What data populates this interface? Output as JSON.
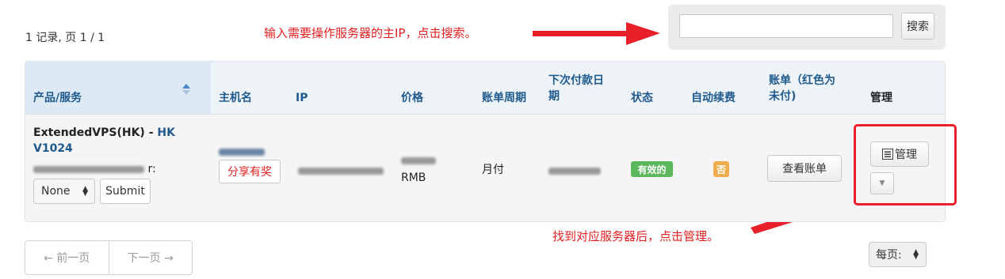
{
  "record_summary": "1 记录, 页 1 / 1",
  "annotations": {
    "search_hint": "输入需要操作服务器的主IP，点击搜索。",
    "manage_hint": "找到对应服务器后，点击管理。"
  },
  "search": {
    "button_label": "搜索",
    "value": ""
  },
  "table": {
    "headers": {
      "product": "产品/服务",
      "hostname": "主机名",
      "ip": "IP",
      "price": "价格",
      "billing_cycle": "账单周期",
      "next_due_line1": "下次付款日",
      "next_due_line2": "期",
      "status": "状态",
      "auto_renew": "自动续费",
      "invoice_line1": "账单（红色为",
      "invoice_line2": "未付)",
      "manage": "管理"
    },
    "row": {
      "product_prefix": "ExtendedVPS(HK) - ",
      "product_link_line1": "HK",
      "product_link_line2": "V1024",
      "label_suffix": "r:",
      "select_value": "None",
      "submit_label": "Submit",
      "share_label": "分享有奖",
      "price_currency": "RMB",
      "billing_cycle": "月付",
      "status": "有效的",
      "auto_renew": "否",
      "invoice_button": "查看账单",
      "manage_button": "管理"
    }
  },
  "pagination": {
    "prev": "← 前一页",
    "next": "下一页 →",
    "per_page": "每页:"
  },
  "colors": {
    "annotation_red": "#e02020",
    "header_blue": "#1f5a8c",
    "status_green": "#5cb85c",
    "auto_renew_orange": "#f0ad4e"
  }
}
